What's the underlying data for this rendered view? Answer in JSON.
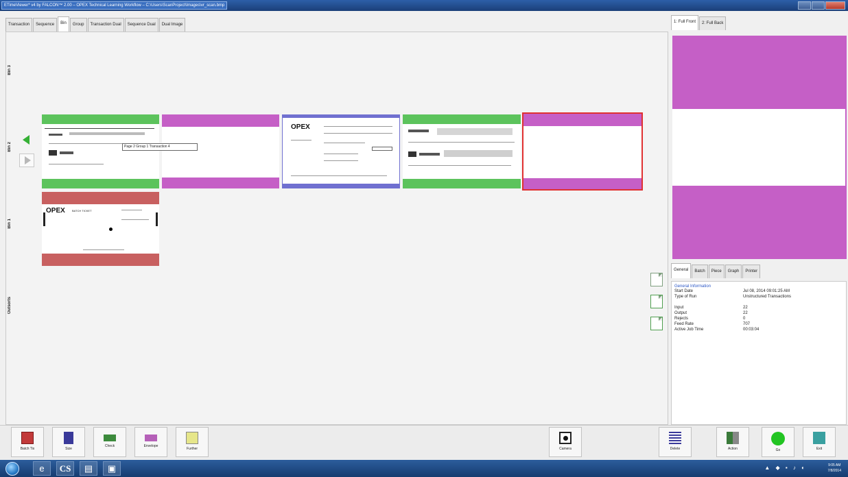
{
  "window": {
    "title": "ETimeViewer* v4 by FALCON™ 2.00 – OPEX Technical Learning Workflow – C:\\Users\\ScanProject\\Images\\vr_scan.bmp"
  },
  "left_tabs": [
    {
      "label": "Transaction",
      "active": false
    },
    {
      "label": "Sequence",
      "active": false
    },
    {
      "label": "Bin",
      "active": true
    },
    {
      "label": "Group",
      "active": false
    },
    {
      "label": "Transaction Dual",
      "active": false
    },
    {
      "label": "Sequence Dual",
      "active": false
    },
    {
      "label": "Dual Image",
      "active": false
    }
  ],
  "bins": {
    "bin3": "Bin 3",
    "bin2": "Bin 2",
    "bin1": "Bin 1",
    "outsorts": "Outsorts"
  },
  "documents": [
    {
      "kind": "check",
      "band_color": "#5cc35c",
      "selected": false
    },
    {
      "kind": "envelope",
      "band_color": "#c55fc6",
      "selected": false
    },
    {
      "kind": "form",
      "band_color": "#7070d0",
      "selected": false,
      "brand": "OPEX"
    },
    {
      "kind": "check",
      "band_color": "#5cc35c",
      "selected": false
    },
    {
      "kind": "envelope",
      "band_color": "#c55fc6",
      "selected": true
    },
    {
      "kind": "batch-ticket",
      "band_color": "#c86060",
      "selected": false,
      "brand": "OPEX",
      "caption": "BATCH TICKET"
    }
  ],
  "tooltip": "Page 2 Group 1 Transaction 4",
  "right_tabs": [
    {
      "label": "1: Full Front",
      "active": true
    },
    {
      "label": "2: Full Back",
      "active": false
    }
  ],
  "info_tabs": [
    {
      "label": "General",
      "active": true
    },
    {
      "label": "Batch",
      "active": false
    },
    {
      "label": "Piece",
      "active": false
    },
    {
      "label": "Graph",
      "active": false
    },
    {
      "label": "Printer",
      "active": false
    }
  ],
  "info": {
    "heading": "General Information",
    "rows_top": [
      {
        "label": "Start Date",
        "value": "Jul 08, 2014 09:01:25 AM"
      },
      {
        "label": "Type of Run",
        "value": "Unstructured Transactions"
      }
    ],
    "rows_bottom": [
      {
        "label": "Input",
        "value": "22"
      },
      {
        "label": "Output",
        "value": "22"
      },
      {
        "label": "Rejects",
        "value": "0"
      },
      {
        "label": "Feed Rate",
        "value": "707"
      },
      {
        "label": "Active Job Time",
        "value": "00:03:04"
      }
    ]
  },
  "toolbar": {
    "batch_ticket": "Batch Tix",
    "size": "Size",
    "check": "Check",
    "envelope": "Envelope",
    "further": "Further",
    "camera": "Camera",
    "delete": "Delete",
    "action": "Action",
    "go": "Go",
    "exit": "Exit"
  },
  "taskbar": {
    "cs_label": "CS",
    "time": "9:05 AM",
    "date": "7/8/2014"
  }
}
